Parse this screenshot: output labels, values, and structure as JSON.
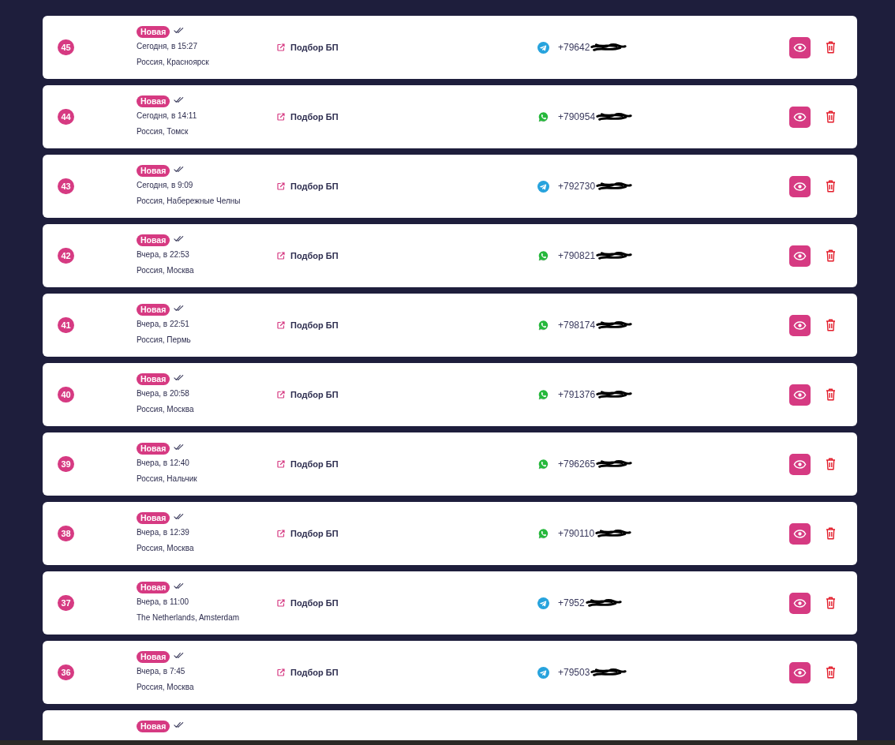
{
  "rows": [
    {
      "number": "45",
      "status": "Новая",
      "viewed": true,
      "date": "Сегодня, в 15:27",
      "location": "Россия, Красноярск",
      "service": "Подбор БП",
      "contact": {
        "kind": "telegram",
        "phone": "+79642",
        "redacted": true
      }
    },
    {
      "number": "44",
      "status": "Новая",
      "viewed": true,
      "date": "Сегодня, в 14:11",
      "location": "Россия, Томск",
      "service": "Подбор БП",
      "contact": {
        "kind": "whatsapp",
        "phone": "+790954",
        "redacted": true
      }
    },
    {
      "number": "43",
      "status": "Новая",
      "viewed": true,
      "date": "Сегодня, в 9:09",
      "location": "Россия, Набережные Челны",
      "service": "Подбор БП",
      "contact": {
        "kind": "telegram",
        "phone": "+792730",
        "redacted": true
      }
    },
    {
      "number": "42",
      "status": "Новая",
      "viewed": true,
      "date": "Вчера, в 22:53",
      "location": "Россия, Москва",
      "service": "Подбор БП",
      "contact": {
        "kind": "whatsapp",
        "phone": "+790821",
        "redacted": true
      }
    },
    {
      "number": "41",
      "status": "Новая",
      "viewed": true,
      "date": "Вчера, в 22:51",
      "location": "Россия, Пермь",
      "service": "Подбор БП",
      "contact": {
        "kind": "whatsapp",
        "phone": "+798174",
        "redacted": true
      }
    },
    {
      "number": "40",
      "status": "Новая",
      "viewed": true,
      "date": "Вчера, в 20:58",
      "location": "Россия, Москва",
      "service": "Подбор БП",
      "contact": {
        "kind": "whatsapp",
        "phone": "+791376",
        "redacted": true
      }
    },
    {
      "number": "39",
      "status": "Новая",
      "viewed": true,
      "date": "Вчера, в 12:40",
      "location": "Россия, Нальчик",
      "service": "Подбор БП",
      "contact": {
        "kind": "whatsapp",
        "phone": "+796265",
        "redacted": true
      }
    },
    {
      "number": "38",
      "status": "Новая",
      "viewed": true,
      "date": "Вчера, в 12:39",
      "location": "Россия, Москва",
      "service": "Подбор БП",
      "contact": {
        "kind": "whatsapp",
        "phone": "+790110",
        "redacted": true
      }
    },
    {
      "number": "37",
      "status": "Новая",
      "viewed": true,
      "date": "Вчера, в 11:00",
      "location": "The Netherlands, Amsterdam",
      "service": "Подбор БП",
      "contact": {
        "kind": "telegram",
        "phone": "+7952",
        "redacted": true
      }
    },
    {
      "number": "36",
      "status": "Новая",
      "viewed": true,
      "date": "Вчера, в 7:45",
      "location": "Россия, Москва",
      "service": "Подбор БП",
      "contact": {
        "kind": "telegram",
        "phone": "+79503",
        "redacted": true
      }
    },
    {
      "status": "Новая",
      "viewed": true
    }
  ]
}
